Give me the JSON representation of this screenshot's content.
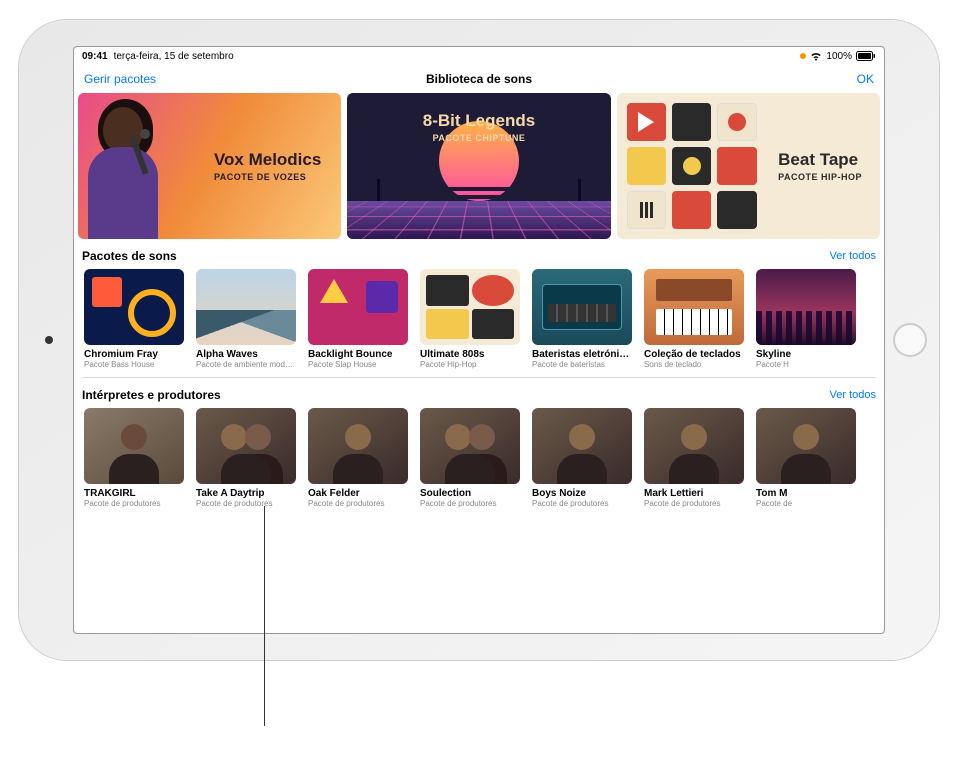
{
  "status": {
    "time": "09:41",
    "date": "terça-feira, 15 de setembro",
    "battery_pct": "100%"
  },
  "nav": {
    "left": "Gerir pacotes",
    "title": "Biblioteca de sons",
    "right": "OK"
  },
  "featured": [
    {
      "title": "Vox Melodics",
      "subtitle": "PACOTE DE VOZES"
    },
    {
      "title": "8-Bit Legends",
      "subtitle": "PACOTE CHIPTUNE"
    },
    {
      "title": "Beat Tape",
      "subtitle": "PACOTE HIP-HOP"
    }
  ],
  "sections": {
    "packs": {
      "header": "Pacotes de sons",
      "see_all": "Ver todos",
      "items": [
        {
          "title": "Chromium Fray",
          "subtitle": "Pacote Bass House"
        },
        {
          "title": "Alpha Waves",
          "subtitle": "Pacote de ambiente moderno"
        },
        {
          "title": "Backlight Bounce",
          "subtitle": "Pacote Slap House"
        },
        {
          "title": "Ultimate 808s",
          "subtitle": "Pacote Hip-Hop"
        },
        {
          "title": "Bateristas eletrónicos",
          "subtitle": "Pacote de bateristas"
        },
        {
          "title": "Coleção de teclados",
          "subtitle": "Sons de teclado"
        },
        {
          "title": "Skyline",
          "subtitle": "Pacote H"
        }
      ]
    },
    "artists": {
      "header": "Intérpretes e produtores",
      "see_all": "Ver todos",
      "items": [
        {
          "title": "TRAKGIRL",
          "subtitle": "Pacote de produtores"
        },
        {
          "title": "Take A Daytrip",
          "subtitle": "Pacote de produtores"
        },
        {
          "title": "Oak Felder",
          "subtitle": "Pacote de produtores"
        },
        {
          "title": "Soulection",
          "subtitle": "Pacote de produtores"
        },
        {
          "title": "Boys Noize",
          "subtitle": "Pacote de produtores"
        },
        {
          "title": "Mark Lettieri",
          "subtitle": "Pacote de produtores"
        },
        {
          "title": "Tom M",
          "subtitle": "Pacote de"
        }
      ]
    }
  }
}
